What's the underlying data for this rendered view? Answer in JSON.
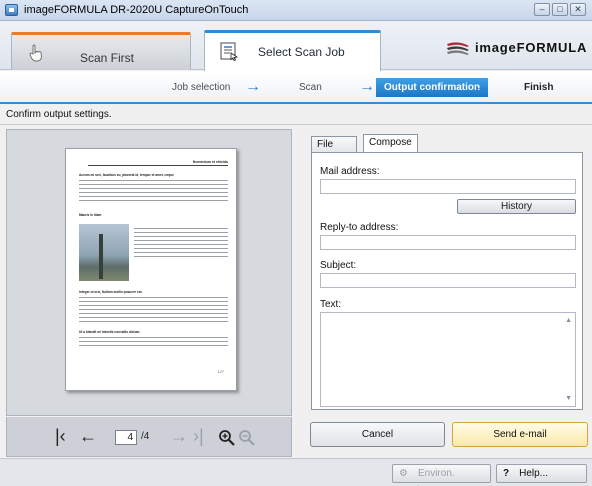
{
  "window": {
    "title": "imageFORMULA DR-2020U CaptureOnTouch",
    "controls": [
      "minimize",
      "maximize",
      "close"
    ]
  },
  "mode_tabs": [
    {
      "label": "Scan First",
      "icon": "hand-pointer-icon"
    },
    {
      "label": "Select Scan Job",
      "icon": "scanner-job-icon"
    }
  ],
  "brand": {
    "name": "imageFORMULA"
  },
  "steps": [
    {
      "label": "Job selection",
      "state": "done"
    },
    {
      "label": "Scan",
      "state": "done"
    },
    {
      "label": "Output confirmation",
      "state": "active"
    },
    {
      "label": "Finish",
      "state": "pending"
    }
  ],
  "instruction": "Confirm output settings.",
  "preview": {
    "page_title": "Nomenlum et ehicids",
    "headings": [
      "Aceum mi orci, faucibus eu, placerat id, tempor et amet, neque",
      "Mauris in diam",
      "Integer ut orci, Nullam mollis posuere est.",
      "Ut a blandit mi lobortis convallis dictum."
    ],
    "page_number_label": "127"
  },
  "navigation": {
    "current_page": "4",
    "total_label": "/4"
  },
  "tabs": [
    {
      "label": "File settings",
      "active": false
    },
    {
      "label": "Compose e-mail",
      "active": true
    }
  ],
  "form": {
    "mail_address_label": "Mail address:",
    "mail_address_value": "",
    "history_label": "History",
    "reply_to_label": "Reply-to address:",
    "reply_to_value": "",
    "subject_label": "Subject:",
    "subject_value": "",
    "text_label": "Text:",
    "text_value": ""
  },
  "actions": {
    "cancel_label": "Cancel",
    "send_label": "Send e-mail"
  },
  "footer": {
    "env_settings_label": "Environ. Settings",
    "help_label": "Help..."
  }
}
